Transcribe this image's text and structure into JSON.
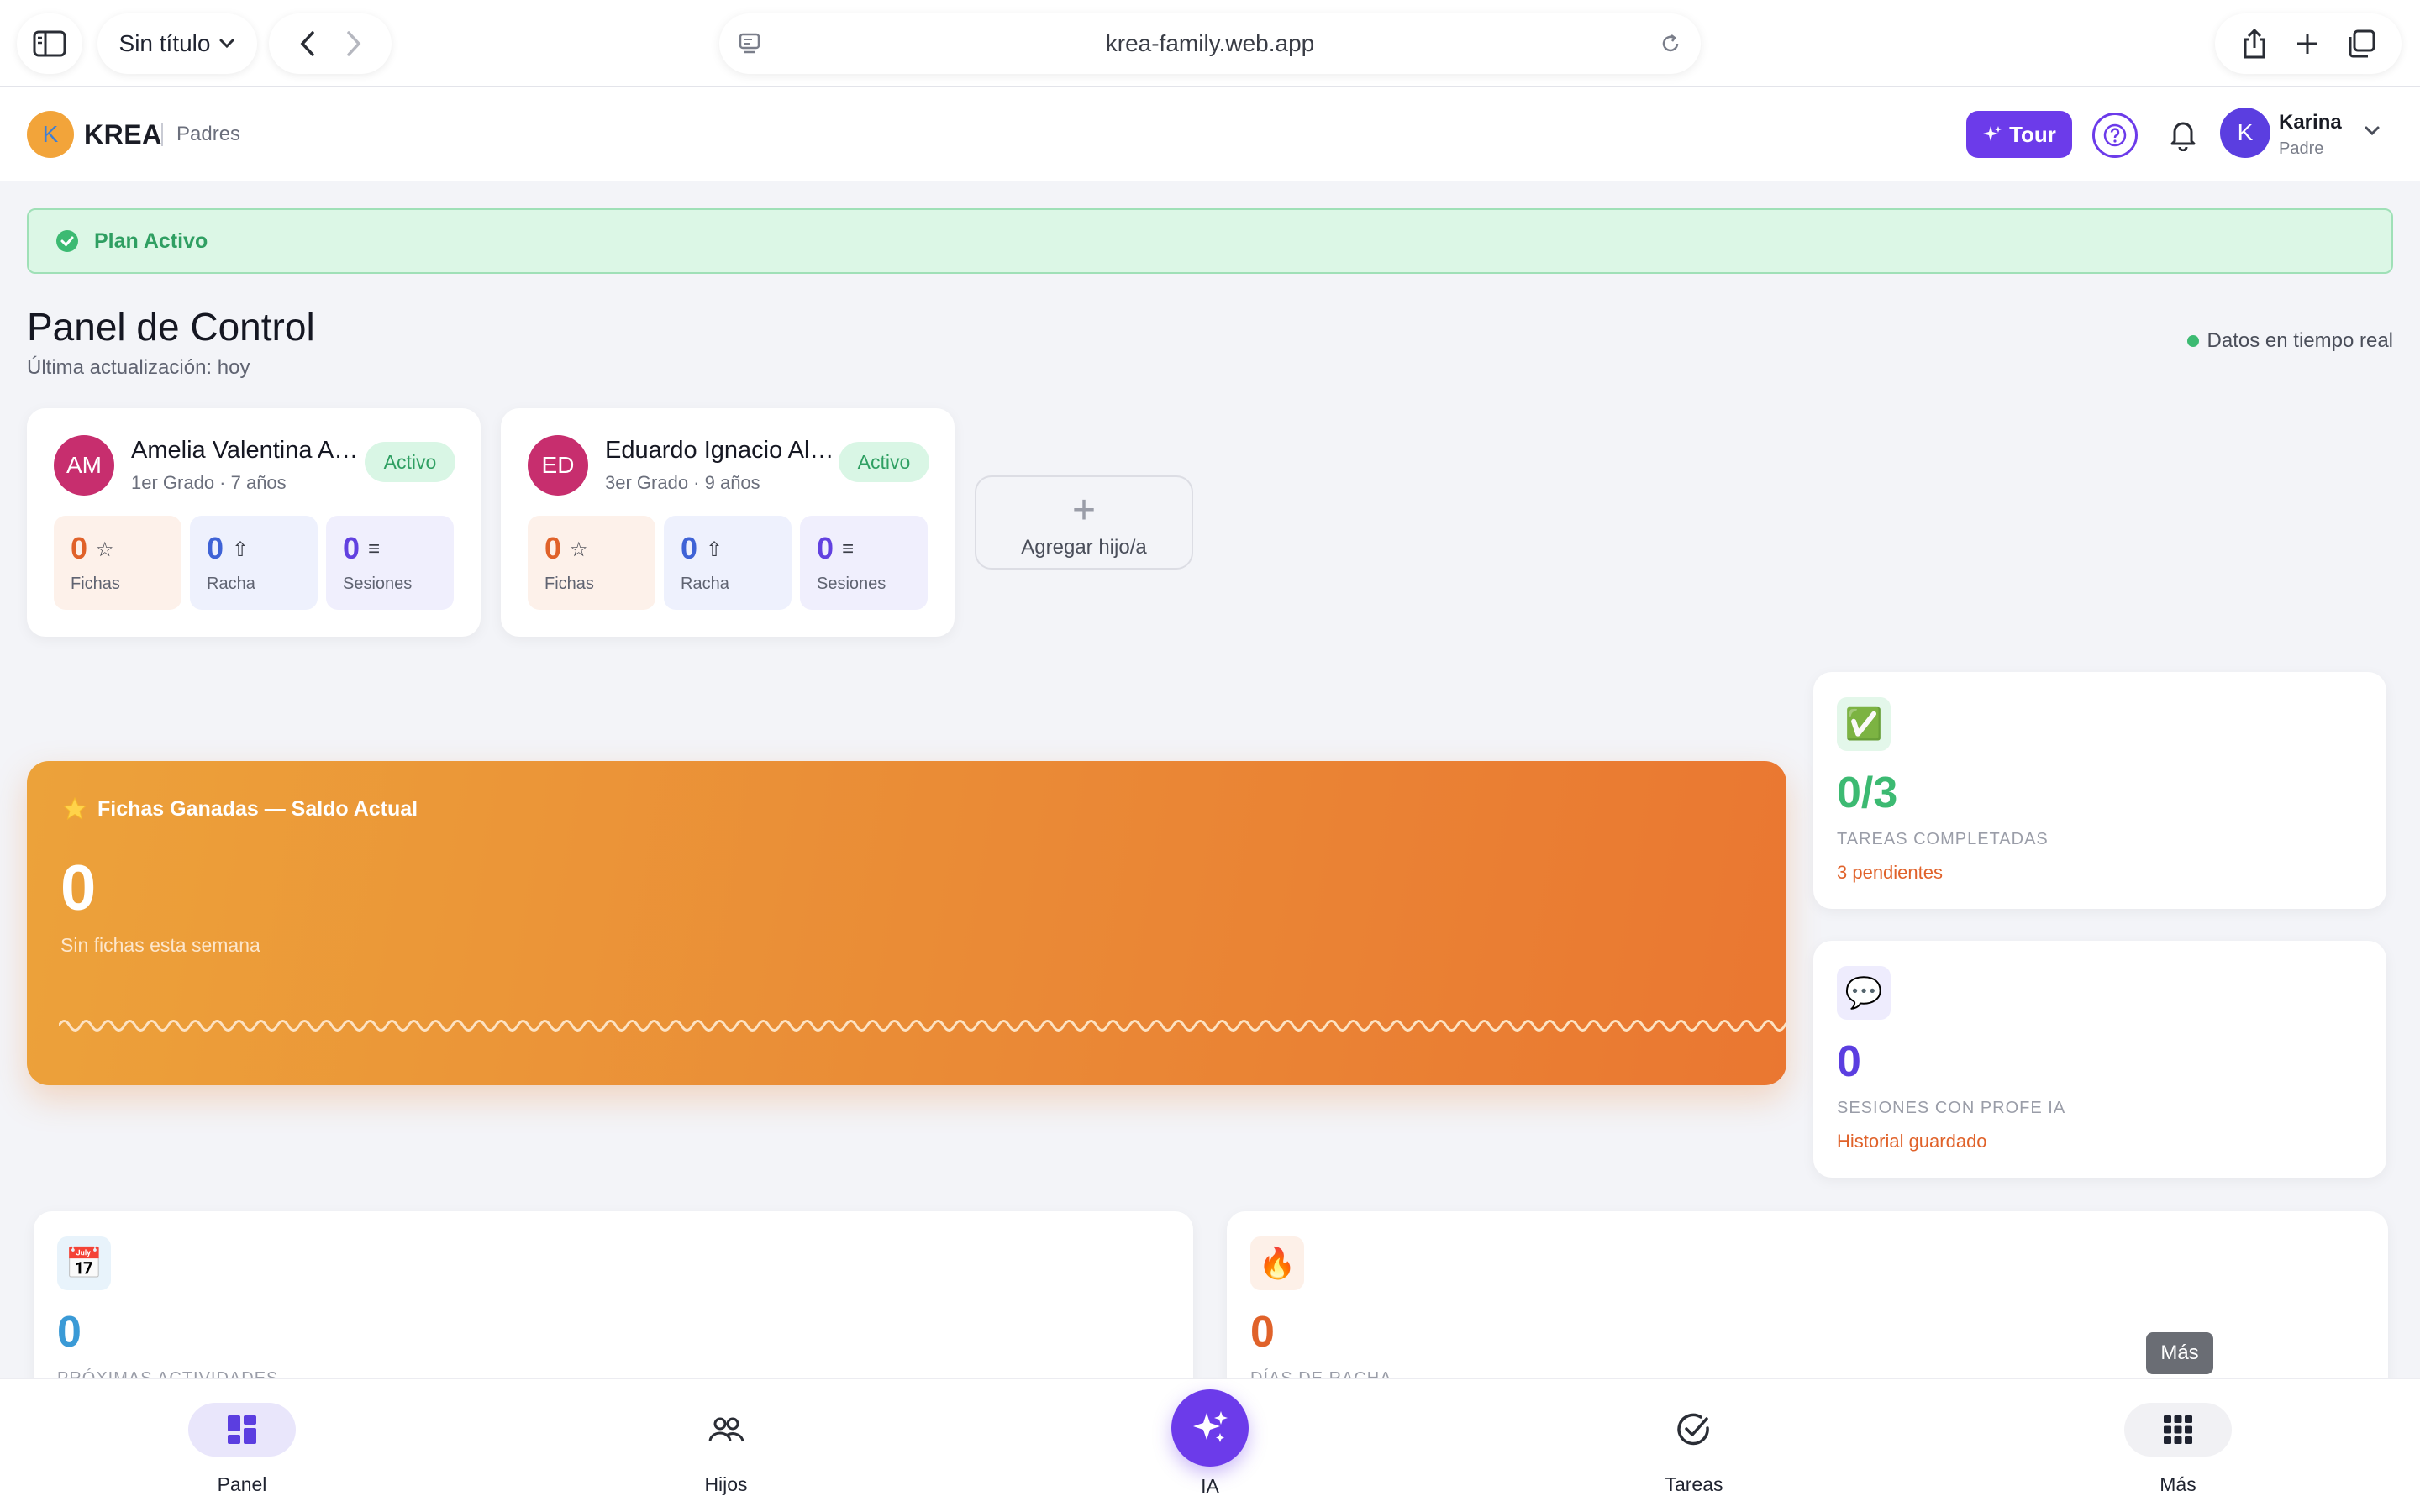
{
  "browser": {
    "tab_title": "Sin título",
    "url": "krea-family.web.app"
  },
  "header": {
    "logo_letter": "K",
    "brand": "KREA",
    "section": "Padres",
    "tour_label": "Tour",
    "user": {
      "initial": "K",
      "name": "Karina",
      "role": "Padre"
    }
  },
  "plan_banner": {
    "text": "Plan Activo"
  },
  "page": {
    "title": "Panel de Control",
    "subtitle": "Última actualización: hoy",
    "realtime": "Datos en tiempo real"
  },
  "children": [
    {
      "initials": "AM",
      "name": "Amelia Valentina Alvarez",
      "meta": "1er Grado · 7 años",
      "status": "Activo",
      "stats": [
        {
          "value": "0",
          "symbol": "☆",
          "label": "Fichas"
        },
        {
          "value": "0",
          "symbol": "⇧",
          "label": "Racha"
        },
        {
          "value": "0",
          "symbol": "≡",
          "label": "Sesiones"
        }
      ]
    },
    {
      "initials": "ED",
      "name": "Eduardo Ignacio Alarcón",
      "meta": "3er Grado · 9 años",
      "status": "Activo",
      "stats": [
        {
          "value": "0",
          "symbol": "☆",
          "label": "Fichas"
        },
        {
          "value": "0",
          "symbol": "⇧",
          "label": "Racha"
        },
        {
          "value": "0",
          "symbol": "≡",
          "label": "Sesiones"
        }
      ]
    }
  ],
  "add_child": {
    "plus": "+",
    "label": "Agregar hijo/a"
  },
  "tokens": {
    "title": "Fichas Ganadas — Saldo Actual",
    "value": "0",
    "subtitle": "Sin fichas esta semana"
  },
  "side_cards": [
    {
      "icon": "✅",
      "value": "0/3",
      "label": "TAREAS COMPLETADAS",
      "note": "3 pendientes"
    },
    {
      "icon": "💬",
      "value": "0",
      "label": "SESIONES CON PROFE IA",
      "note": "Historial guardado"
    }
  ],
  "bottom_cards": [
    {
      "icon": "📅",
      "value": "0",
      "label": "PRÓXIMAS ACTIVIDADES"
    },
    {
      "icon": "🔥",
      "value": "0",
      "label": "DÍAS DE RACHA"
    }
  ],
  "tooltip": "Más",
  "bottom_nav": {
    "panel": "Panel",
    "hijos": "Hijos",
    "ia": "IA",
    "tareas": "Tareas",
    "mas": "Más"
  },
  "colors": {
    "accent": "#6c3bea",
    "success": "#2f9f62",
    "orange": "#e0622a",
    "tokens_gradient_start": "#eca23a",
    "tokens_gradient_end": "#ea7731"
  }
}
